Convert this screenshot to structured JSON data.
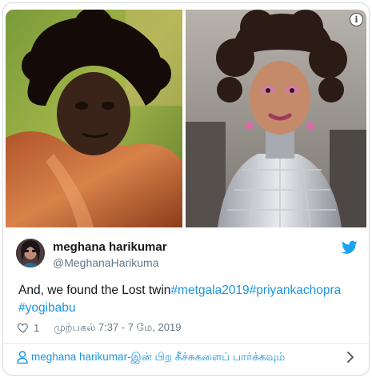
{
  "tweet": {
    "author_name": "meghana harikumar",
    "author_handle": "@MeghanaHarikuma",
    "text_plain": "And, we found the Lost twin",
    "hashtags": [
      "#metgala2019",
      "#priyankachopra",
      "#yogibabu"
    ],
    "like_count": "1",
    "timestamp": "முற்பகல் 7:37 - 7 மே, 2019",
    "more_link": "meghana harikumar-இன் பிற கீச்சுகளைப் பார்க்கவும்"
  },
  "icons": {
    "info": "info-icon",
    "brand": "twitter-bird-icon",
    "like": "heart-icon",
    "profile": "person-icon",
    "chevron": "chevron-right-icon"
  },
  "colors": {
    "link": "#1b95e0",
    "muted": "#657786",
    "text": "#14171a",
    "border": "#d6dbe0"
  }
}
